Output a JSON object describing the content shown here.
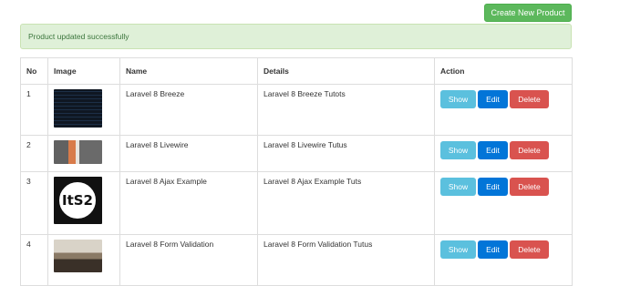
{
  "header": {
    "create_button_label": "Create New Product"
  },
  "alert": {
    "message": "Product updated successfully"
  },
  "table": {
    "columns": [
      "No",
      "Image",
      "Name",
      "Details",
      "Action"
    ],
    "rows": [
      {
        "no": "1",
        "image": "laravel-breeze-thumbnail",
        "name": "Laravel 8 Breeze",
        "details": "Laravel 8 Breeze Tutots"
      },
      {
        "no": "2",
        "image": "laravel-livewire-thumbnail",
        "name": "Laravel 8 Livewire",
        "details": "Laravel 8 Livewire Tutus"
      },
      {
        "no": "3",
        "image": "its2-logo-thumbnail",
        "image_text": "ItS2",
        "name": "Laravel 8 Ajax Example",
        "details": "Laravel 8 Ajax Example Tuts"
      },
      {
        "no": "4",
        "image": "laravel-form-validation-thumbnail",
        "name": "Laravel 8 Form Validation",
        "details": "Laravel 8 Form Validation Tutus"
      }
    ],
    "actions": {
      "show": "Show",
      "edit": "Edit",
      "delete": "Delete"
    }
  },
  "colors": {
    "success": "#5cb85c",
    "alert_bg": "#dff0d8",
    "info": "#5bc0de",
    "primary": "#0275d8",
    "danger": "#d9534f"
  }
}
